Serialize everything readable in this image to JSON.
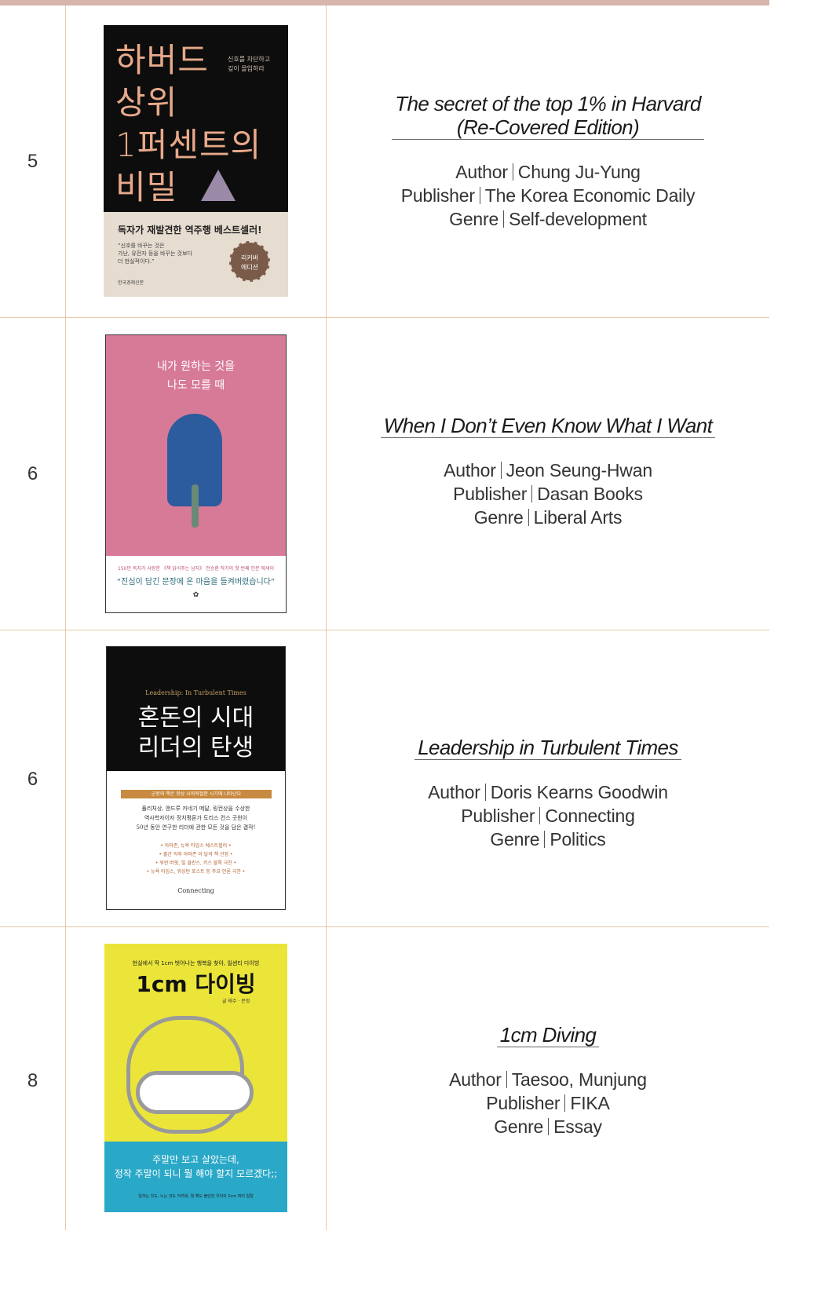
{
  "books": [
    {
      "rank": "5",
      "title_lines": [
        "The secret of the top 1% in Harvard",
        "(Re-Covered Edition)"
      ],
      "author_label": "Author",
      "author": "Chung Ju-Yung",
      "publisher_label": "Publisher",
      "publisher": "The Korea Economic Daily",
      "genre_label": "Genre",
      "genre": "Self-development",
      "cover": {
        "title_ko": [
          "하버드",
          "상위",
          "1퍼센트의",
          "비밀"
        ],
        "subtitle_ko": [
          "신호를 차단하고",
          "깊이 몰입하라"
        ],
        "headline_ko": "독자가 재발견한 역주행 베스트셀러!",
        "quote_ko": [
          "“신호를 바꾸는 것은",
          "가난, 유전자 등을 바꾸는 것보다",
          "더 현실적이다.”"
        ],
        "badge_ko": [
          "리커버",
          "에디션"
        ],
        "publisher_ko": "한국경제신문"
      }
    },
    {
      "rank": "6",
      "title_lines": [
        "When I Don’t Even Know What I Want"
      ],
      "author_label": "Author",
      "author": "Jeon Seung-Hwan",
      "publisher_label": "Publisher",
      "publisher": "Dasan Books",
      "genre_label": "Genre",
      "genre": "Liberal Arts",
      "cover": {
        "title_ko": [
          "내가 원하는 것을",
          "나도 모를 때"
        ],
        "tagline_ko": "150만 독자가 사랑한 《책 읽어주는 남자》 전승환 작가의 첫 번째 인문 에세이",
        "quote_ko": "“진심이 담긴 문장에 온 마음을 들켜버렸습니다”"
      }
    },
    {
      "rank": "6",
      "title_lines": [
        "Leadership in Turbulent Times"
      ],
      "author_label": "Author",
      "author": "Doris Kearns Goodwin",
      "publisher_label": "Publisher",
      "publisher": "Connecting",
      "genre_label": "Genre",
      "genre": "Politics",
      "cover": {
        "title_en": "Leadership: In Turbulent Times",
        "title_ko": [
          "혼돈의 시대",
          "리더의 탄생"
        ],
        "band_ko": "군왕의 책은 항상 시의적절한 시기에 나타난다",
        "body_ko": [
          "퓰리처상, 앤드루 카네기 메달, 링컨상을 수상한",
          "역사학자이자 정치평론가 도리스 컨스 굿윈이",
          "50년 동안 연구한 리더에 관한 모든 것을 담은 결작!"
        ],
        "list_ko": [
          "• 아마존, 뉴욕 타임스 베스트셀러 •",
          "• 출간 직후 아마존 이 달의 책 선정 •",
          "• 워런 버핏, 빌 클린스, 키스 블룩 극찬 •",
          "• 뉴욕 타임스, 워싱턴 포스트 등 주요 언론 극찬 •"
        ],
        "publisher_en": "Connecting"
      }
    },
    {
      "rank": "8",
      "title_lines": [
        "1cm Diving"
      ],
      "author_label": "Author",
      "author": "Taesoo, Munjung",
      "publisher_label": "Publisher",
      "publisher": "FIKA",
      "genre_label": "Genre",
      "genre": "Essay",
      "cover": {
        "tag_ko": "현실에서 딱 1cm 벗어나는 행복을 찾아, 일센티 다이빙",
        "title_ko": "1cm 다이빙",
        "author_ko": "글 태수 · 문정",
        "sea_ko": [
          "주말만 보고 살았는데,",
          "정작 주말이 되니 뭘 해야 할지 모르겠다;;"
        ],
        "footer_ko": "일하는 것도, 노는 것도 어려워, 뭘 해도 불안한 우리의 1cm 짜리 일탈"
      }
    }
  ]
}
